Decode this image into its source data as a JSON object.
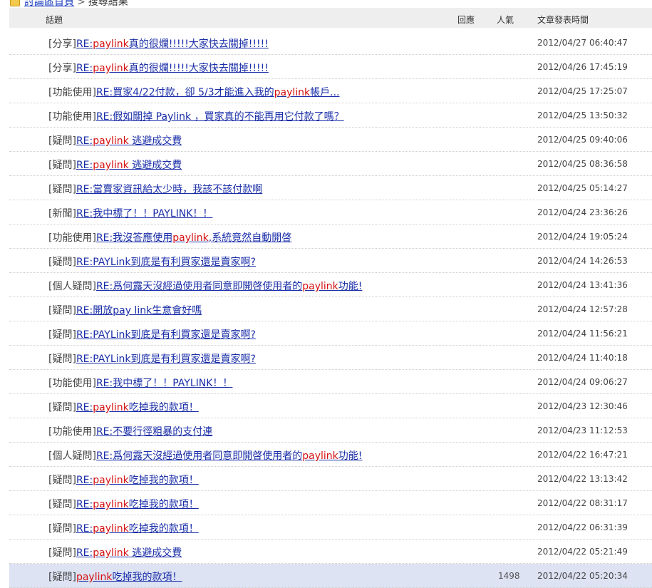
{
  "breadcrumb": {
    "home": "討論區首頁",
    "separator": ">",
    "current": "搜尋結果"
  },
  "columns": {
    "topic": "話題",
    "replies": "回應",
    "views": "人氣",
    "time": "文章發表時間"
  },
  "rows": [
    {
      "category": "[分享]",
      "title": [
        {
          "t": "RE:"
        },
        {
          "t": "paylink",
          "kw": true
        },
        {
          "t": "真的很爛!!!!!大家快去關掉!!!!!"
        }
      ],
      "views": "",
      "time": "2012/04/27 06:40:47"
    },
    {
      "category": "[分享]",
      "title": [
        {
          "t": "RE:"
        },
        {
          "t": "paylink",
          "kw": true
        },
        {
          "t": "真的很爛!!!!!大家快去關掉!!!!!"
        }
      ],
      "views": "",
      "time": "2012/04/26 17:45:19"
    },
    {
      "category": "[功能使用]",
      "title": [
        {
          "t": "RE:買家4/22付款，卻 5/3才能進入我的"
        },
        {
          "t": "paylink",
          "kw": true
        },
        {
          "t": "帳戶..."
        }
      ],
      "views": "",
      "time": "2012/04/25 17:25:07"
    },
    {
      "category": "[功能使用]",
      "title": [
        {
          "t": "RE:假如關掉 Paylink ，買家真的不能再用它付款了嗎？"
        }
      ],
      "views": "",
      "time": "2012/04/25 13:50:32"
    },
    {
      "category": "[疑問]",
      "title": [
        {
          "t": "RE:"
        },
        {
          "t": "paylink",
          "kw": true
        },
        {
          "t": " 逃避成交費"
        }
      ],
      "views": "",
      "time": "2012/04/25 09:40:06"
    },
    {
      "category": "[疑問]",
      "title": [
        {
          "t": "RE:"
        },
        {
          "t": "paylink",
          "kw": true
        },
        {
          "t": " 逃避成交費"
        }
      ],
      "views": "",
      "time": "2012/04/25 08:36:58"
    },
    {
      "category": "[疑問]",
      "title": [
        {
          "t": "RE:當賣家資訊給太少時，我該不該付款啊"
        }
      ],
      "views": "",
      "time": "2012/04/25 05:14:27"
    },
    {
      "category": "[新聞]",
      "title": [
        {
          "t": "RE:我中標了！！PAYLINK！！"
        }
      ],
      "views": "",
      "time": "2012/04/24 23:36:26"
    },
    {
      "category": "[功能使用]",
      "title": [
        {
          "t": "RE:我沒答應使用"
        },
        {
          "t": "paylink",
          "kw": true
        },
        {
          "t": ",系統竟然自動開啓"
        }
      ],
      "views": "",
      "time": "2012/04/24 19:05:24"
    },
    {
      "category": "[疑問]",
      "title": [
        {
          "t": "RE:PAYLink到底是有利買家還是賣家啊?"
        }
      ],
      "views": "",
      "time": "2012/04/24 14:26:53"
    },
    {
      "category": "[個人疑問]",
      "title": [
        {
          "t": "RE:爲何露天沒經過使用者同意即開啓使用者的"
        },
        {
          "t": "paylink",
          "kw": true
        },
        {
          "t": "功能!"
        }
      ],
      "views": "",
      "time": "2012/04/24 13:41:36"
    },
    {
      "category": "[疑問]",
      "title": [
        {
          "t": "RE:開放pay link生意會好嗎"
        }
      ],
      "views": "",
      "time": "2012/04/24 12:57:28"
    },
    {
      "category": "[疑問]",
      "title": [
        {
          "t": "RE:PAYLink到底是有利買家還是賣家啊?"
        }
      ],
      "views": "",
      "time": "2012/04/24 11:56:21"
    },
    {
      "category": "[疑問]",
      "title": [
        {
          "t": "RE:PAYLink到底是有利買家還是賣家啊?"
        }
      ],
      "views": "",
      "time": "2012/04/24 11:40:18"
    },
    {
      "category": "[功能使用]",
      "title": [
        {
          "t": "RE:我中標了！！PAYLINK！！"
        }
      ],
      "views": "",
      "time": "2012/04/24 09:06:27"
    },
    {
      "category": "[疑問]",
      "title": [
        {
          "t": "RE:"
        },
        {
          "t": "paylink",
          "kw": true
        },
        {
          "t": "吃掉我的款項！"
        }
      ],
      "views": "",
      "time": "2012/04/23 12:30:46"
    },
    {
      "category": "[功能使用]",
      "title": [
        {
          "t": "RE:不要行徑粗暴的支付連"
        }
      ],
      "views": "",
      "time": "2012/04/23 11:12:53"
    },
    {
      "category": "[個人疑問]",
      "title": [
        {
          "t": "RE:爲何露天沒經過使用者同意即開啓使用者的"
        },
        {
          "t": "paylink",
          "kw": true
        },
        {
          "t": "功能!"
        }
      ],
      "views": "",
      "time": "2012/04/22 16:47:21"
    },
    {
      "category": "[疑問]",
      "title": [
        {
          "t": "RE:"
        },
        {
          "t": "paylink",
          "kw": true
        },
        {
          "t": "吃掉我的款項！"
        }
      ],
      "views": "",
      "time": "2012/04/22 13:13:42"
    },
    {
      "category": "[疑問]",
      "title": [
        {
          "t": "RE:"
        },
        {
          "t": "paylink",
          "kw": true
        },
        {
          "t": "吃掉我的款項！"
        }
      ],
      "views": "",
      "time": "2012/04/22 08:31:17"
    },
    {
      "category": "[疑問]",
      "title": [
        {
          "t": "RE:"
        },
        {
          "t": "paylink",
          "kw": true
        },
        {
          "t": "吃掉我的款項！"
        }
      ],
      "views": "",
      "time": "2012/04/22 06:31:39"
    },
    {
      "category": "[疑問]",
      "title": [
        {
          "t": "RE:"
        },
        {
          "t": "paylink",
          "kw": true
        },
        {
          "t": " 逃避成交費"
        }
      ],
      "views": "",
      "time": "2012/04/22 05:21:49"
    },
    {
      "category": "[疑問]",
      "title": [
        {
          "t": "paylink",
          "kw": true
        },
        {
          "t": "吃掉我的款項！"
        }
      ],
      "views": "1498",
      "time": "2012/04/22 05:20:34",
      "highlight": true
    }
  ],
  "colors": {
    "link": "#1a2ea8",
    "keyword": "#d51010",
    "header_bg": "#eeeeee",
    "highlight_bg": "#dde3f3"
  }
}
